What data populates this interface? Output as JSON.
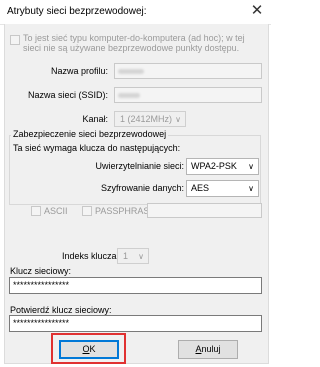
{
  "window": {
    "title": "Atrybuty sieci bezprzewodowej:",
    "close_symbol": "✕"
  },
  "adhoc": {
    "text_line1": "To jest sieć typu komputer-do-komputera (ad hoc); w tej",
    "text_line2": "sieci nie są używane bezprzewodowe punkty dostępu.",
    "checked": false
  },
  "profile": {
    "profile_name_label": "Nazwa profilu:",
    "ssid_label": "Nazwa sieci (SSID):",
    "channel_label": "Kanał:",
    "channel_value": "1 (2412MHz)"
  },
  "security": {
    "group_label": "Zabezpieczenie sieci bezprzewodowej",
    "requires_label": "Ta sieć wymaga klucza do następujących:",
    "auth_label": "Uwierzytelnianie sieci:",
    "auth_value": "WPA2-PSK",
    "enc_label": "Szyfrowanie danych:",
    "enc_value": "AES",
    "ascii_label": "ASCII",
    "passphrase_label": "PASSPHRASE"
  },
  "key": {
    "index_label": "Indeks klucza",
    "index_value": "1",
    "network_key_label": "Klucz sieciowy:",
    "network_key_value": "****************",
    "confirm_label": "Potwierdź klucz sieciowy:",
    "confirm_value": "****************"
  },
  "buttons": {
    "ok_label": "OK",
    "ok_accel": "O",
    "ok_rest": "K",
    "cancel_label": "Anuluj",
    "cancel_accel": "A",
    "cancel_rest": "nuluj"
  },
  "colors": {
    "highlight": "#e03131",
    "focus": "#0078d7"
  }
}
